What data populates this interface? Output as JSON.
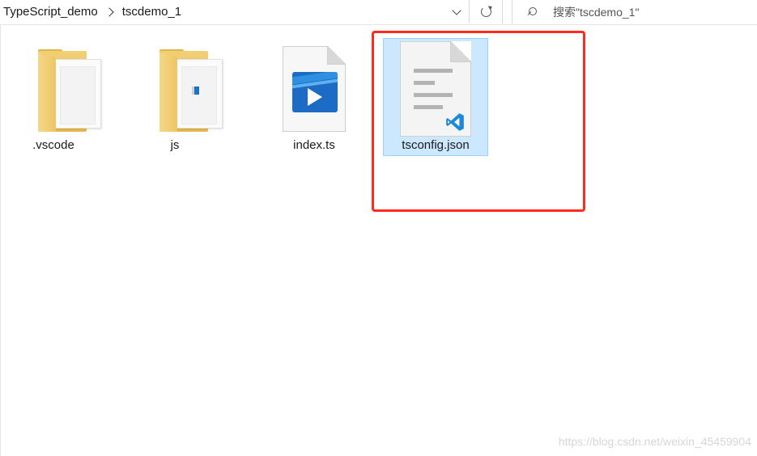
{
  "address_bar": {
    "breadcrumbs": [
      "TypeScript_demo",
      "tscdemo_1"
    ]
  },
  "search": {
    "placeholder": "搜索\"tscdemo_1\""
  },
  "files": [
    {
      "name": ".vscode",
      "type": "folder",
      "icon": "folder-icon"
    },
    {
      "name": "js",
      "type": "folder",
      "icon": "folder-icon"
    },
    {
      "name": "index.ts",
      "type": "file",
      "icon": "typescript-file-icon"
    },
    {
      "name": "tsconfig.json",
      "type": "file",
      "icon": "json-vscode-file-icon",
      "selected": true
    }
  ],
  "colors": {
    "selection_bg": "#cce8ff",
    "selection_border": "#99d1ff",
    "highlight": "#ff2a1a",
    "folder": "#f2cf74"
  },
  "watermark": "https://blog.csdn.net/weixin_45459904"
}
